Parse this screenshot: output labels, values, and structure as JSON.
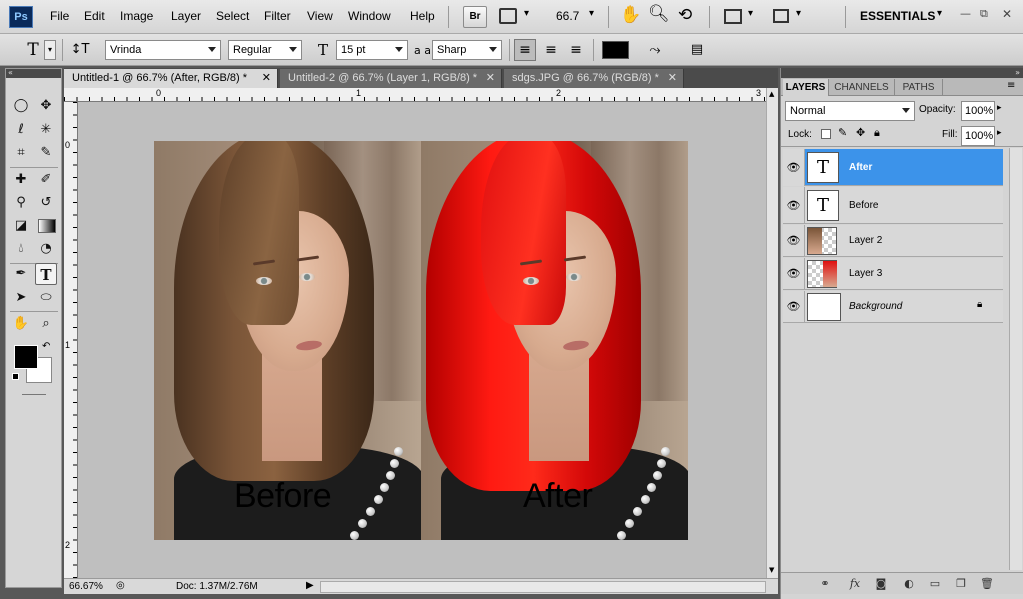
{
  "app": {
    "logo": "Ps",
    "menu": [
      "File",
      "Edit",
      "Image",
      "Layer",
      "Select",
      "Filter",
      "View",
      "Window",
      "Help"
    ],
    "bridge_button": "Br",
    "zoom": "66.7",
    "workspace": "ESSENTIALS",
    "window_controls": [
      "—",
      "⧉",
      "✕"
    ]
  },
  "options": {
    "font_family": "Vrinda",
    "font_style": "Regular",
    "font_size": "15 pt",
    "aa_label": "a a",
    "antialias": "Sharp",
    "text_color": "#000000"
  },
  "tabs": [
    {
      "label": "Untitled-1 @ 66.7% (After, RGB/8) *",
      "active": true
    },
    {
      "label": "Untitled-2 @ 66.7% (Layer 1, RGB/8) *",
      "active": false
    },
    {
      "label": "sdgs.JPG @ 66.7% (RGB/8) *",
      "active": false
    }
  ],
  "ruler": {
    "top": [
      "0",
      "1",
      "2",
      "3"
    ],
    "left": [
      "0",
      "1",
      "2"
    ]
  },
  "document": {
    "before_text": "Before",
    "after_text": "After",
    "hair_before_color": "#6e4a2c",
    "hair_after_color": "#e01010"
  },
  "status": {
    "zoom": "66.67%",
    "doc": "Doc: 1.37M/2.76M"
  },
  "layers_panel": {
    "tabs": [
      "LAYERS",
      "CHANNELS",
      "PATHS"
    ],
    "blend_mode": "Normal",
    "opacity_label": "Opacity:",
    "opacity": "100%",
    "lock_label": "Lock:",
    "fill_label": "Fill:",
    "fill": "100%",
    "layers": [
      {
        "name": "After",
        "type": "text",
        "selected": true
      },
      {
        "name": "Before",
        "type": "text",
        "selected": false
      },
      {
        "name": "Layer 2",
        "type": "image",
        "selected": false
      },
      {
        "name": "Layer 3",
        "type": "image",
        "selected": false
      },
      {
        "name": "Background",
        "type": "background",
        "selected": false
      }
    ]
  },
  "colors": {
    "foreground": "#000000",
    "background": "#ffffff",
    "selection": "#3c93ea"
  }
}
